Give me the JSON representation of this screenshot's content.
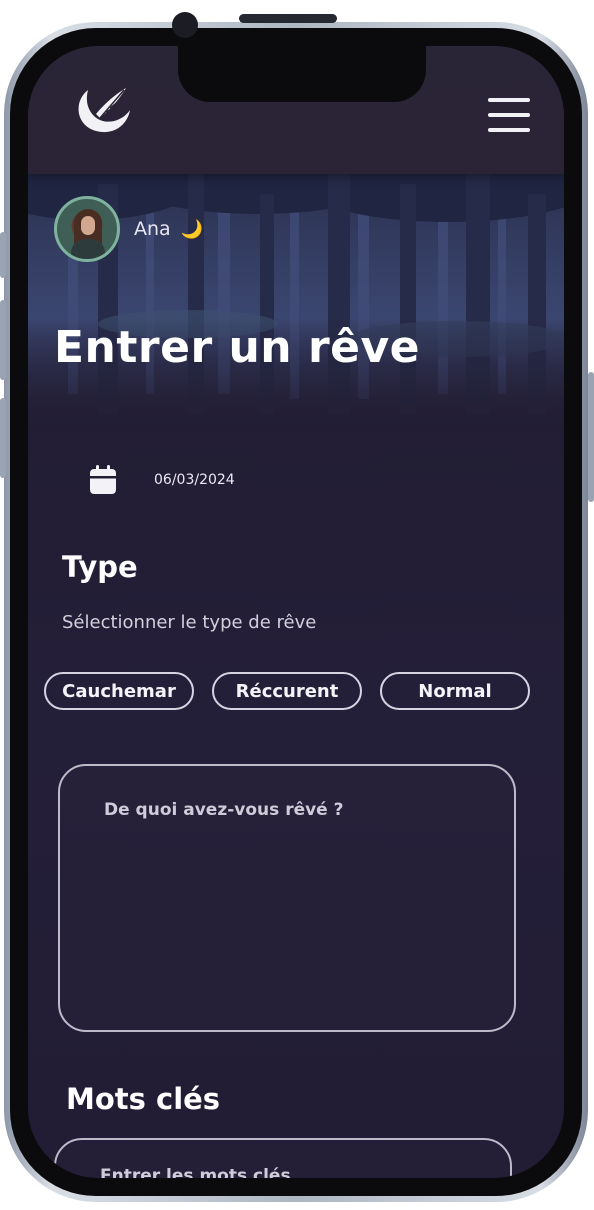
{
  "user": {
    "name": "Ana",
    "status_emoji": "🌙"
  },
  "page": {
    "title": "Entrer un rêve"
  },
  "date": {
    "value": "06/03/2024",
    "icon": "calendar-icon"
  },
  "type_section": {
    "title": "Type",
    "subtitle": "Sélectionner le type de rêve",
    "options": [
      "Cauchemar",
      "Réccurent",
      "Normal"
    ]
  },
  "dream_input": {
    "placeholder": "De quoi avez-vous rêvé ?"
  },
  "keywords_section": {
    "title": "Mots clés",
    "placeholder": "Entrer les mots clés"
  },
  "icons": {
    "logo": "feather-moon-logo",
    "menu": "hamburger-menu-icon"
  },
  "colors": {
    "background": "#221d33",
    "header": "#2a2437",
    "text": "#ffffff",
    "border": "#bdbbc9",
    "moon": "#f3c64a"
  }
}
